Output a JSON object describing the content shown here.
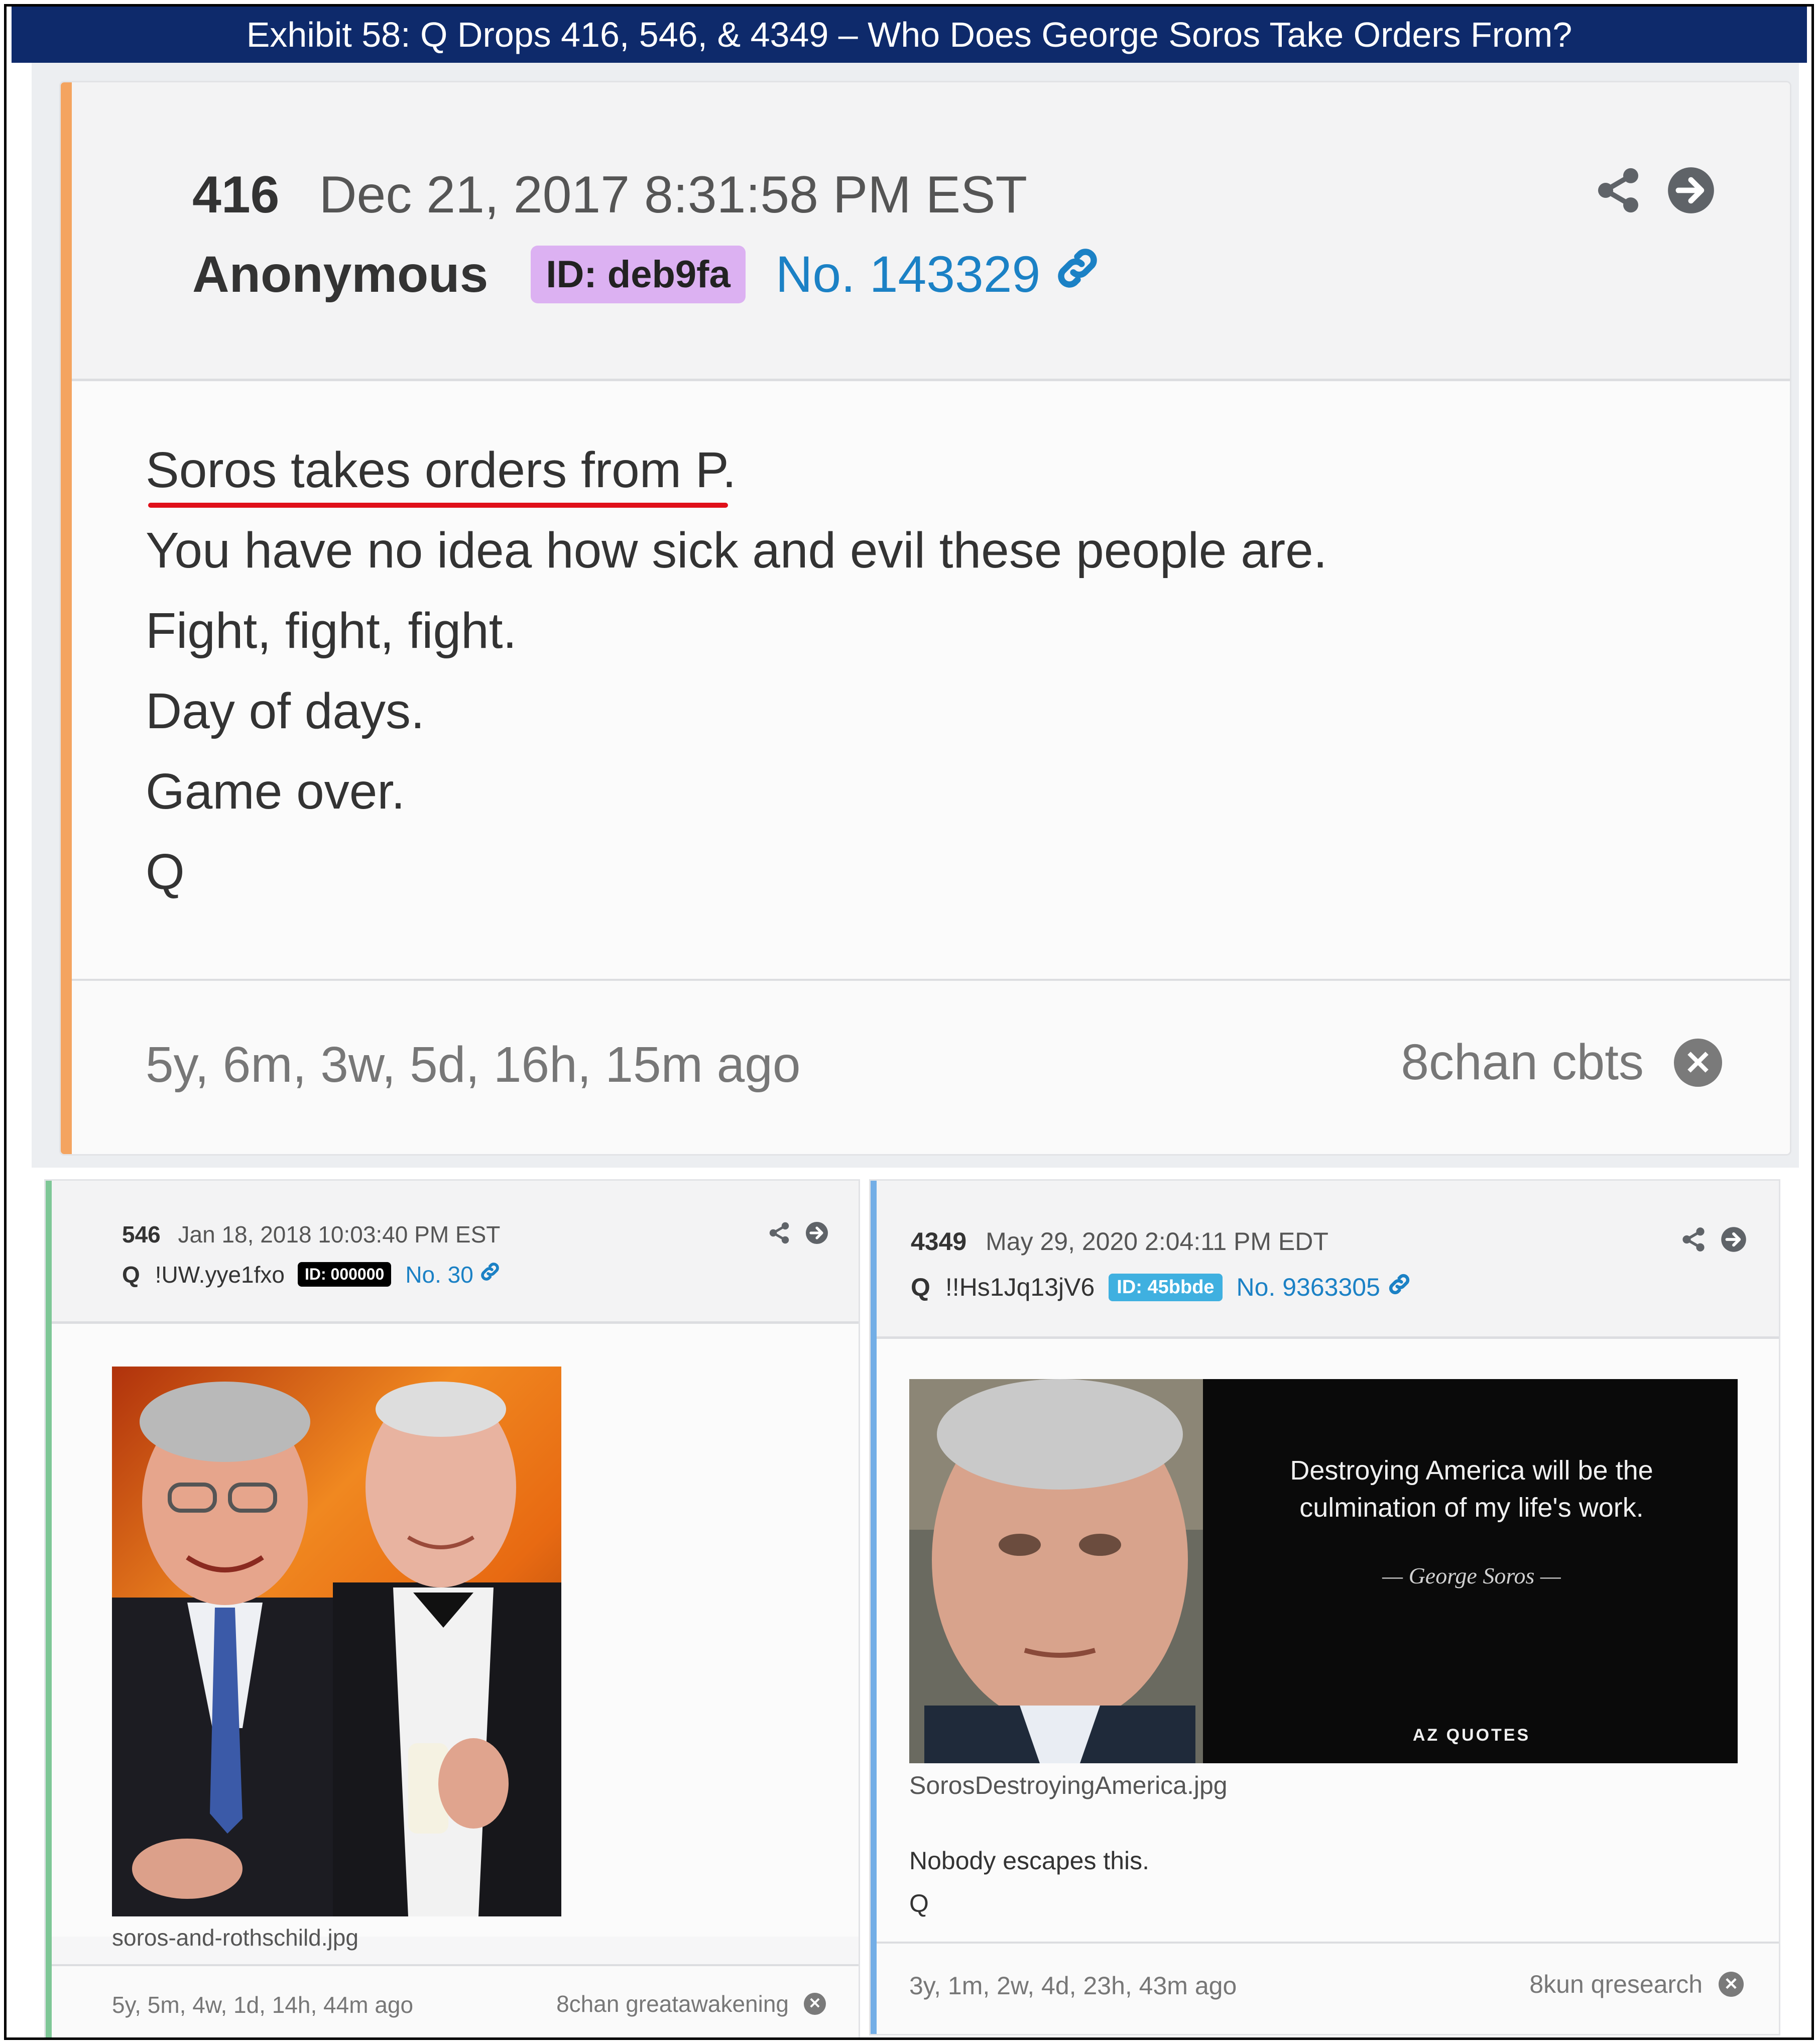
{
  "exhibit_title": "Exhibit 58: Q Drops 416, 546, & 4349 – Who Does George Soros Take Orders From?",
  "colors": {
    "title_bg": "#0e2a6b",
    "accent_top": "#f4a460",
    "accent_left": "#7ec796",
    "accent_right": "#73aee6",
    "link": "#1b81c5"
  },
  "posts": [
    {
      "number": "416",
      "date": "Dec 21, 2017 8:31:58 PM EST",
      "author": "Anonymous",
      "tripcode": "",
      "id_badge": "ID: deb9fa",
      "post_no": "No. 143329",
      "lines": [
        "Soros takes orders from P.",
        "You have no idea how sick and evil these people are.",
        "Fight, fight, fight.",
        "Day of days.",
        "Game over.",
        "Q"
      ],
      "ago": "5y, 6m, 3w, 5d, 16h, 15m ago",
      "source": "8chan cbts",
      "icons": [
        "share-icon",
        "arrow-right-circle-icon",
        "link-icon",
        "close-circle-icon"
      ]
    },
    {
      "number": "546",
      "date": "Jan 18, 2018 10:03:40 PM EST",
      "author": "Q",
      "tripcode": "!UW.yye1fxo",
      "id_badge": "ID: 000000",
      "post_no": "No. 30",
      "image_filename": "soros-and-rothschild.jpg",
      "ago": "5y, 5m, 4w, 1d, 14h, 44m ago",
      "source": "8chan greatawakening"
    },
    {
      "number": "4349",
      "date": "May 29, 2020 2:04:11 PM EDT",
      "author": "Q",
      "tripcode": "!!Hs1Jq13jV6",
      "id_badge": "ID: 45bbde",
      "post_no": "No. 9363305",
      "image_filename": "SorosDestroyingAmerica.jpg",
      "image_quote": "Destroying America will be the culmination of my life's work.",
      "image_attribution": "— George Soros —",
      "image_watermark": "AZ QUOTES",
      "lines": [
        "Nobody escapes this.",
        "Q"
      ],
      "ago": "3y, 1m, 2w, 4d, 23h, 43m ago",
      "source": "8kun qresearch"
    }
  ]
}
